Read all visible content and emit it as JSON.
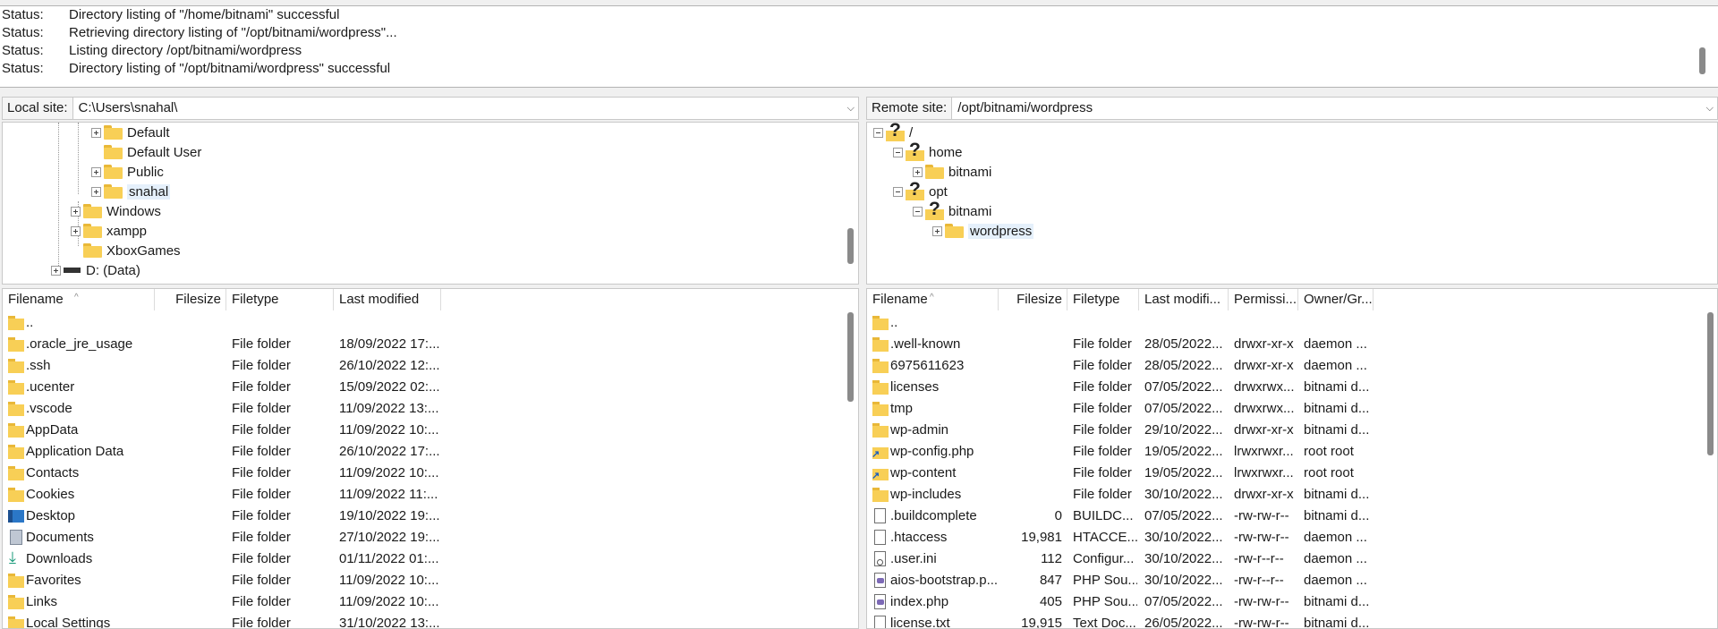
{
  "log": [
    {
      "label": "Status:",
      "text": "Directory listing of \"/home/bitnami\" successful"
    },
    {
      "label": "Status:",
      "text": "Retrieving directory listing of \"/opt/bitnami/wordpress\"..."
    },
    {
      "label": "Status:",
      "text": "Listing directory /opt/bitnami/wordpress"
    },
    {
      "label": "Status:",
      "text": "Directory listing of \"/opt/bitnami/wordpress\" successful"
    }
  ],
  "local": {
    "label": "Local site:",
    "path": "C:\\Users\\snahal\\",
    "tree": [
      "Default",
      "Default User",
      "Public",
      "snahal",
      "Windows",
      "xampp",
      "XboxGames",
      "D: (Data)"
    ],
    "columns": [
      "Filename",
      "Filesize",
      "Filetype",
      "Last modified"
    ],
    "files": [
      {
        "name": "..",
        "size": "",
        "type": "",
        "modified": "",
        "icon": "folder-icon"
      },
      {
        "name": ".oracle_jre_usage",
        "size": "",
        "type": "File folder",
        "modified": "18/09/2022 17:...",
        "icon": "folder-icon"
      },
      {
        "name": ".ssh",
        "size": "",
        "type": "File folder",
        "modified": "26/10/2022 12:...",
        "icon": "folder-icon"
      },
      {
        "name": ".ucenter",
        "size": "",
        "type": "File folder",
        "modified": "15/09/2022 02:...",
        "icon": "folder-icon"
      },
      {
        "name": ".vscode",
        "size": "",
        "type": "File folder",
        "modified": "11/09/2022 13:...",
        "icon": "folder-icon"
      },
      {
        "name": "AppData",
        "size": "",
        "type": "File folder",
        "modified": "11/09/2022 10:...",
        "icon": "folder-icon"
      },
      {
        "name": "Application Data",
        "size": "",
        "type": "File folder",
        "modified": "26/10/2022 17:...",
        "icon": "folder-icon"
      },
      {
        "name": "Contacts",
        "size": "",
        "type": "File folder",
        "modified": "11/09/2022 10:...",
        "icon": "folder-icon"
      },
      {
        "name": "Cookies",
        "size": "",
        "type": "File folder",
        "modified": "11/09/2022 11:...",
        "icon": "folder-icon"
      },
      {
        "name": "Desktop",
        "size": "",
        "type": "File folder",
        "modified": "19/10/2022 19:...",
        "icon": "desktop-icon"
      },
      {
        "name": "Documents",
        "size": "",
        "type": "File folder",
        "modified": "27/10/2022 19:...",
        "icon": "documents-icon"
      },
      {
        "name": "Downloads",
        "size": "",
        "type": "File folder",
        "modified": "01/11/2022 01:...",
        "icon": "download-icon"
      },
      {
        "name": "Favorites",
        "size": "",
        "type": "File folder",
        "modified": "11/09/2022 10:...",
        "icon": "folder-icon"
      },
      {
        "name": "Links",
        "size": "",
        "type": "File folder",
        "modified": "11/09/2022 10:...",
        "icon": "folder-icon"
      },
      {
        "name": "Local Settings",
        "size": "",
        "type": "File folder",
        "modified": "31/10/2022 13:...",
        "icon": "folder-icon"
      }
    ]
  },
  "remote": {
    "label": "Remote site:",
    "path": "/opt/bitnami/wordpress",
    "tree": [
      "/",
      "home",
      "bitnami",
      "opt",
      "bitnami",
      "wordpress"
    ],
    "columns": [
      "Filename",
      "Filesize",
      "Filetype",
      "Last modifi...",
      "Permissi...",
      "Owner/Gr..."
    ],
    "files": [
      {
        "name": "..",
        "size": "",
        "type": "",
        "modified": "",
        "perms": "",
        "owner": "",
        "icon": "folder-icon"
      },
      {
        "name": ".well-known",
        "size": "",
        "type": "File folder",
        "modified": "28/05/2022...",
        "perms": "drwxr-xr-x",
        "owner": "daemon ...",
        "icon": "folder-icon"
      },
      {
        "name": "6975611623",
        "size": "",
        "type": "File folder",
        "modified": "28/05/2022...",
        "perms": "drwxr-xr-x",
        "owner": "daemon ...",
        "icon": "folder-icon"
      },
      {
        "name": "licenses",
        "size": "",
        "type": "File folder",
        "modified": "07/05/2022...",
        "perms": "drwxrwx...",
        "owner": "bitnami d...",
        "icon": "folder-icon"
      },
      {
        "name": "tmp",
        "size": "",
        "type": "File folder",
        "modified": "07/05/2022...",
        "perms": "drwxrwx...",
        "owner": "bitnami d...",
        "icon": "folder-icon"
      },
      {
        "name": "wp-admin",
        "size": "",
        "type": "File folder",
        "modified": "29/10/2022...",
        "perms": "drwxr-xr-x",
        "owner": "bitnami d...",
        "icon": "folder-icon"
      },
      {
        "name": "wp-config.php",
        "size": "",
        "type": "File folder",
        "modified": "19/05/2022...",
        "perms": "lrwxrwxr...",
        "owner": "root root",
        "icon": "symlink-folder-icon"
      },
      {
        "name": "wp-content",
        "size": "",
        "type": "File folder",
        "modified": "19/05/2022...",
        "perms": "lrwxrwxr...",
        "owner": "root root",
        "icon": "symlink-folder-icon"
      },
      {
        "name": "wp-includes",
        "size": "",
        "type": "File folder",
        "modified": "30/10/2022...",
        "perms": "drwxr-xr-x",
        "owner": "bitnami d...",
        "icon": "folder-icon"
      },
      {
        "name": ".buildcomplete",
        "size": "0",
        "type": "BUILDC...",
        "modified": "07/05/2022...",
        "perms": "-rw-rw-r--",
        "owner": "bitnami d...",
        "icon": "file-icon"
      },
      {
        "name": ".htaccess",
        "size": "19,981",
        "type": "HTACCE...",
        "modified": "30/10/2022...",
        "perms": "-rw-rw-r--",
        "owner": "daemon ...",
        "icon": "file-icon"
      },
      {
        "name": ".user.ini",
        "size": "112",
        "type": "Configur...",
        "modified": "30/10/2022...",
        "perms": "-rw-r--r--",
        "owner": "daemon ...",
        "icon": "config-file-icon"
      },
      {
        "name": "aios-bootstrap.p...",
        "size": "847",
        "type": "PHP Sou...",
        "modified": "30/10/2022...",
        "perms": "-rw-r--r--",
        "owner": "daemon ...",
        "icon": "php-file-icon"
      },
      {
        "name": "index.php",
        "size": "405",
        "type": "PHP Sou...",
        "modified": "07/05/2022...",
        "perms": "-rw-rw-r--",
        "owner": "bitnami d...",
        "icon": "php-file-icon"
      },
      {
        "name": "license.txt",
        "size": "19,915",
        "type": "Text Doc...",
        "modified": "26/05/2022...",
        "perms": "-rw-rw-r--",
        "owner": "bitnami d...",
        "icon": "file-icon"
      }
    ]
  }
}
